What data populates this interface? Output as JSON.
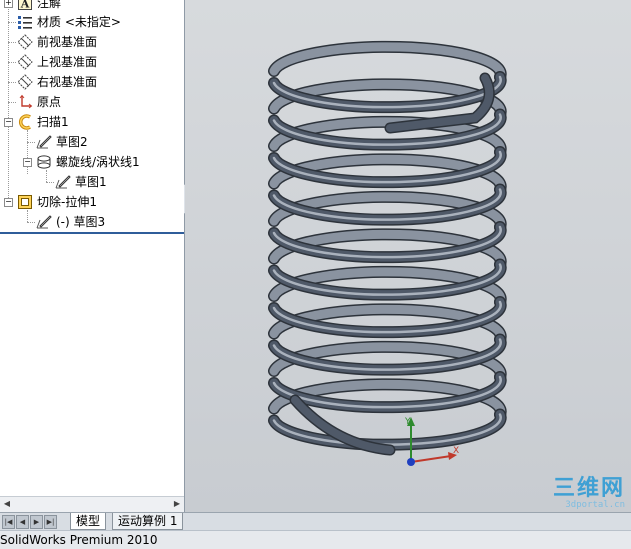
{
  "tree": {
    "items": [
      {
        "label": "注解",
        "icon": "annotations-icon"
      },
      {
        "label": "材质 <未指定>",
        "icon": "material-icon"
      },
      {
        "label": "前视基准面",
        "icon": "plane-icon"
      },
      {
        "label": "上视基准面",
        "icon": "plane-icon"
      },
      {
        "label": "右视基准面",
        "icon": "plane-icon"
      },
      {
        "label": "原点",
        "icon": "origin-icon"
      },
      {
        "label": "扫描1",
        "icon": "sweep-icon"
      },
      {
        "label": "草图2",
        "icon": "sketch-icon"
      },
      {
        "label": "螺旋线/涡状线1",
        "icon": "helix-icon"
      },
      {
        "label": "草图1",
        "icon": "sketch-icon"
      },
      {
        "label": "切除-拉伸1",
        "icon": "cut-extrude-icon"
      },
      {
        "label": "(-) 草图3",
        "icon": "sketch-icon"
      }
    ]
  },
  "triad": {
    "y_label": "Y",
    "x_label": "X"
  },
  "tabs": [
    {
      "label": "模型"
    },
    {
      "label": "运动算例 1"
    }
  ],
  "status": {
    "text": "SolidWorks Premium 2010"
  },
  "watermark": {
    "logo": "三维网",
    "url": "3dportal.cn"
  },
  "colors": {
    "spring": "#4f5968",
    "accent": "#2f5d9a",
    "watermark": "#3fa0d4"
  }
}
